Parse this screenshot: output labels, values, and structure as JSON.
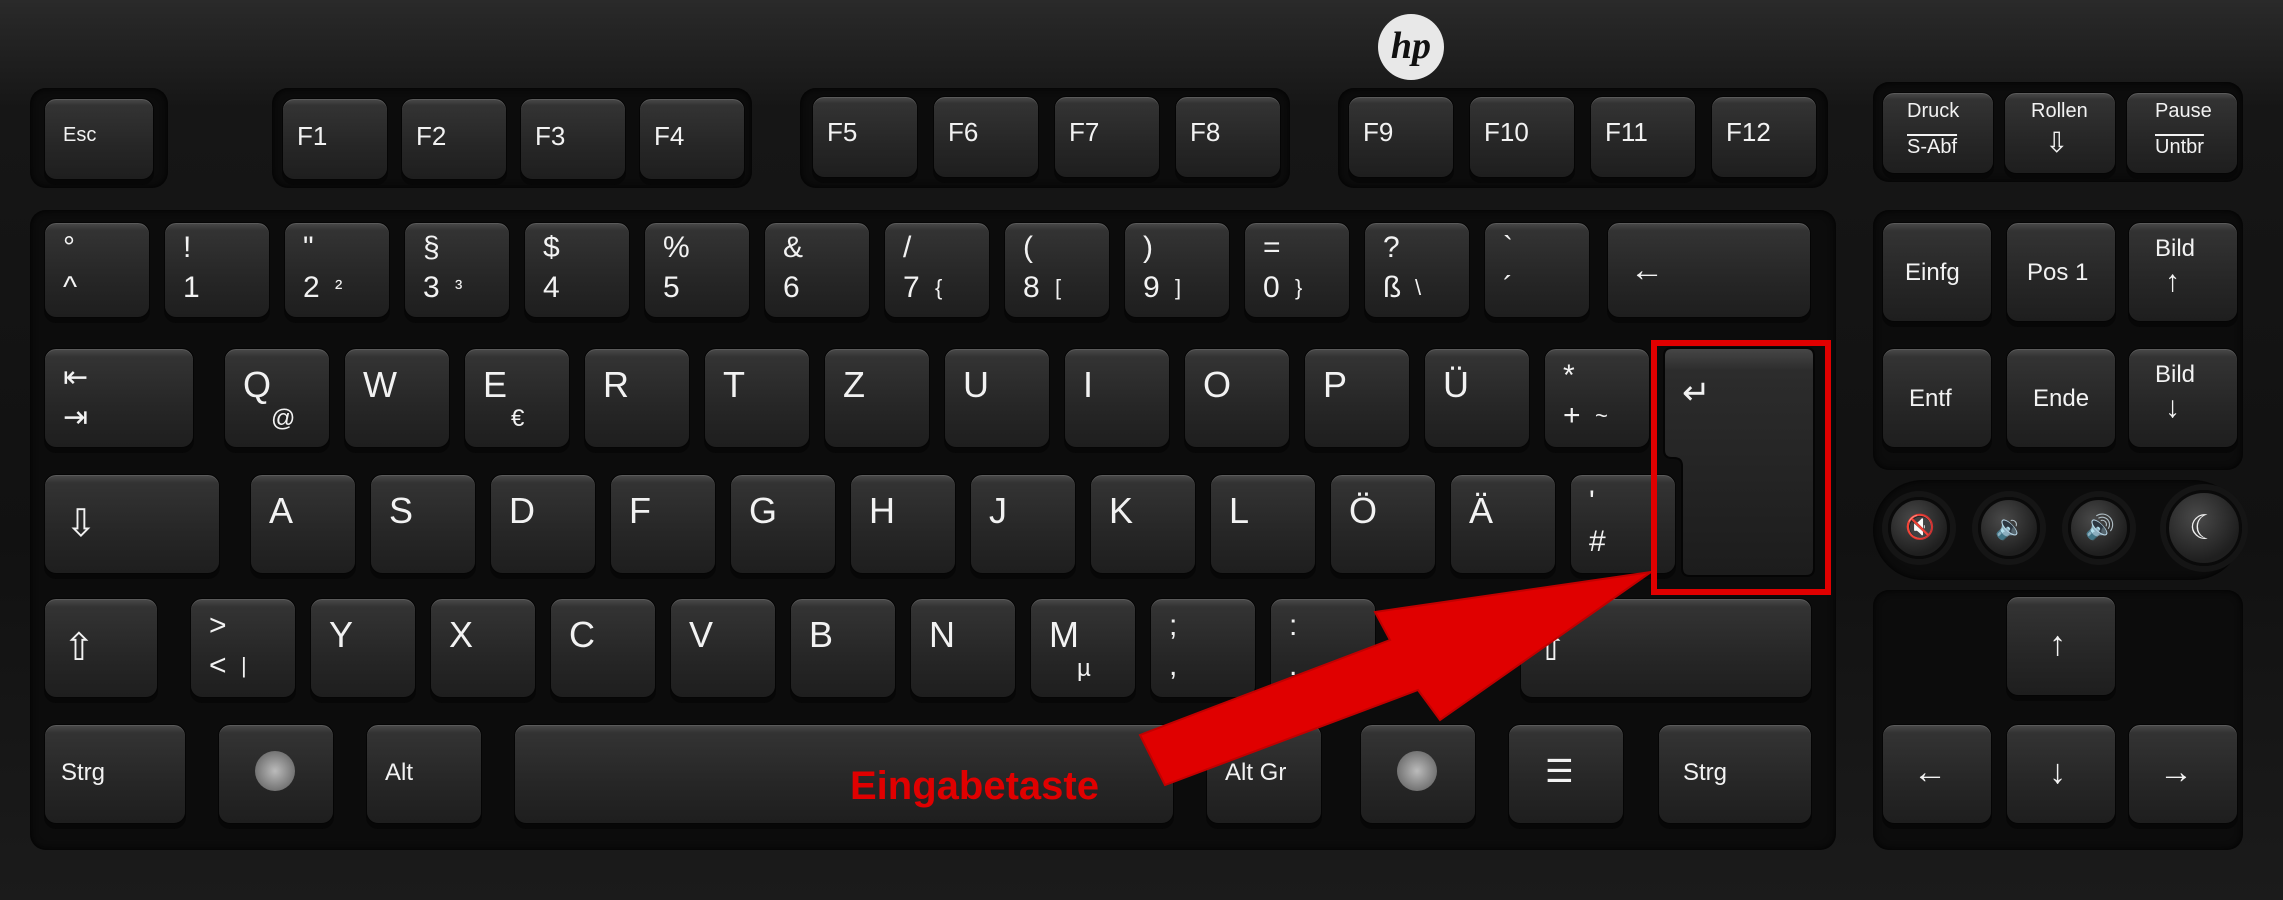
{
  "brand": "hp",
  "callout": {
    "label": "Eingabetaste",
    "color": "#e00000",
    "target": "enter-key"
  },
  "keys": {
    "esc": "Esc",
    "f1": "F1",
    "f2": "F2",
    "f3": "F3",
    "f4": "F4",
    "f5": "F5",
    "f6": "F6",
    "f7": "F7",
    "f8": "F8",
    "f9": "F9",
    "f10": "F10",
    "f11": "F11",
    "f12": "F12",
    "druck_top": "Druck",
    "druck_bottom": "S-Abf",
    "rollen": "Rollen",
    "pause_top": "Pause",
    "pause_bottom": "Untbr",
    "r1": [
      {
        "t": "°",
        "b": "^"
      },
      {
        "t": "!",
        "b": "1"
      },
      {
        "t": "\"",
        "b": "2",
        "r": "²"
      },
      {
        "t": "§",
        "b": "3",
        "r": "³"
      },
      {
        "t": "$",
        "b": "4"
      },
      {
        "t": "%",
        "b": "5"
      },
      {
        "t": "&",
        "b": "6"
      },
      {
        "t": "/",
        "b": "7",
        "r": "{"
      },
      {
        "t": "(",
        "b": "8",
        "r": "["
      },
      {
        "t": ")",
        "b": "9",
        "r": "]"
      },
      {
        "t": "=",
        "b": "0",
        "r": "}"
      },
      {
        "t": "?",
        "b": "ß",
        "r": "\\"
      },
      {
        "t": "`",
        "b": "´"
      }
    ],
    "backspace": "←",
    "r2": [
      {
        "t": "Q",
        "r": "@"
      },
      {
        "t": "W"
      },
      {
        "t": "E",
        "r": "€"
      },
      {
        "t": "R"
      },
      {
        "t": "T"
      },
      {
        "t": "Z"
      },
      {
        "t": "U"
      },
      {
        "t": "I"
      },
      {
        "t": "O"
      },
      {
        "t": "P"
      },
      {
        "t": "Ü"
      },
      {
        "t": "*",
        "b": "+",
        "r": "~"
      }
    ],
    "r3": [
      {
        "t": "A"
      },
      {
        "t": "S"
      },
      {
        "t": "D"
      },
      {
        "t": "F"
      },
      {
        "t": "G"
      },
      {
        "t": "H"
      },
      {
        "t": "J"
      },
      {
        "t": "K"
      },
      {
        "t": "L"
      },
      {
        "t": "Ö"
      },
      {
        "t": "Ä"
      },
      {
        "t": "'",
        "b": "#"
      }
    ],
    "r4": [
      {
        "t": ">",
        "b": "<",
        "r": "|"
      },
      {
        "t": "Y"
      },
      {
        "t": "X"
      },
      {
        "t": "C"
      },
      {
        "t": "V"
      },
      {
        "t": "B"
      },
      {
        "t": "N"
      },
      {
        "t": "M",
        "r": "µ"
      },
      {
        "t": ";",
        "b": ","
      },
      {
        "t": ":",
        "b": "."
      }
    ],
    "strg": "Strg",
    "alt": "Alt",
    "altgr": "Alt Gr",
    "einfg": "Einfg",
    "pos1": "Pos 1",
    "bild": "Bild",
    "entf": "Entf",
    "ende": "Ende"
  }
}
